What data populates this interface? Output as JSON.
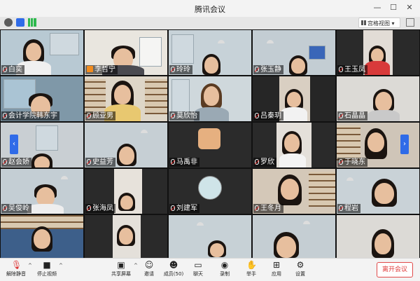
{
  "window": {
    "title": "腾讯会议",
    "minimize": "—",
    "maximize": "☐",
    "close": "✕"
  },
  "top_toolbar": {
    "view_label": "宫格视图",
    "view_caret": "▾"
  },
  "participants": [
    "白奕",
    "李哲宁",
    "玲玲",
    "张玉静",
    "王玉凤",
    "会计学院韩东宇",
    "顾亚男",
    "莫欣怡",
    "吕秦玥",
    "石晶晶",
    "赵会娇",
    "史益芳",
    "马禹非",
    "罗欣",
    "于晓东",
    "吴俊岭",
    "张海凤",
    "刘建军",
    "王冬月",
    "程岩"
  ],
  "nav": {
    "prev": "‹",
    "next": "›"
  },
  "bottom_bar": {
    "mute": "解除静音",
    "stop_video": "停止视频",
    "share_screen": "共享屏幕",
    "invite": "邀请",
    "members": "成员(50)",
    "chat": "聊天",
    "record": "录制",
    "raise_hand": "举手",
    "apps": "应用",
    "settings": "设置",
    "leave": "离开会议"
  },
  "colors": {
    "accent": "#2f6be8",
    "leave_red": "#e03c3c",
    "host_badge": "#f28c1e"
  }
}
